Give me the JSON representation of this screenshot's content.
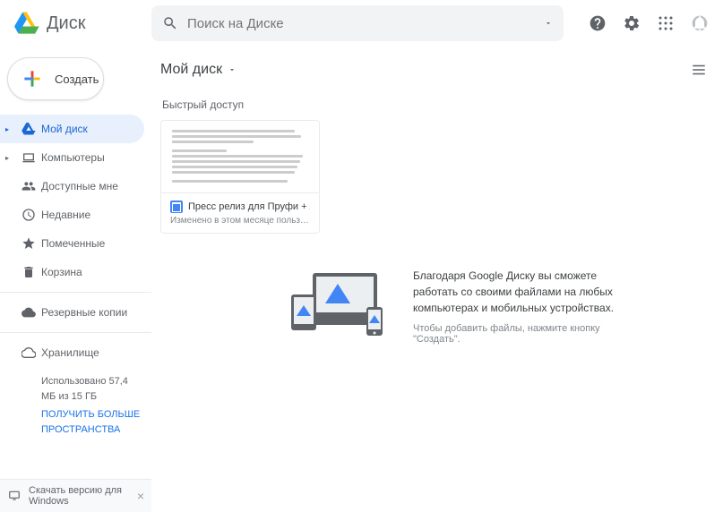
{
  "header": {
    "product_name": "Диск",
    "search_placeholder": "Поиск на Диске"
  },
  "sidebar": {
    "create_label": "Создать",
    "items": [
      {
        "label": "Мой диск",
        "selected": true,
        "expandable": true
      },
      {
        "label": "Компьютеры",
        "selected": false,
        "expandable": true
      },
      {
        "label": "Доступные мне",
        "selected": false,
        "expandable": false
      },
      {
        "label": "Недавние",
        "selected": false,
        "expandable": false
      },
      {
        "label": "Помеченные",
        "selected": false,
        "expandable": false
      },
      {
        "label": "Корзина",
        "selected": false,
        "expandable": false
      }
    ],
    "backups_label": "Резервные копии",
    "storage_label": "Хранилище",
    "storage_usage": "Использовано 57,4 МБ из 15 ГБ",
    "storage_cta": "ПОЛУЧИТЬ БОЛЬШЕ ПРОСТРАНСТВА",
    "download_bar": "Скачать версию для Windows"
  },
  "main": {
    "title": "Мой диск",
    "quick_access_label": "Быстрый доступ",
    "card": {
      "title": "Пресс релиз для Пруфи + легенда ...",
      "subtitle": "Изменено в этом месяце пользователем ..."
    },
    "hero": {
      "title": "Благодаря Google Диску вы сможете работать со своими файлами на любых компьютерах и мобильных устройствах.",
      "subtitle": "Чтобы добавить файлы, нажмите кнопку \"Создать\"."
    }
  }
}
